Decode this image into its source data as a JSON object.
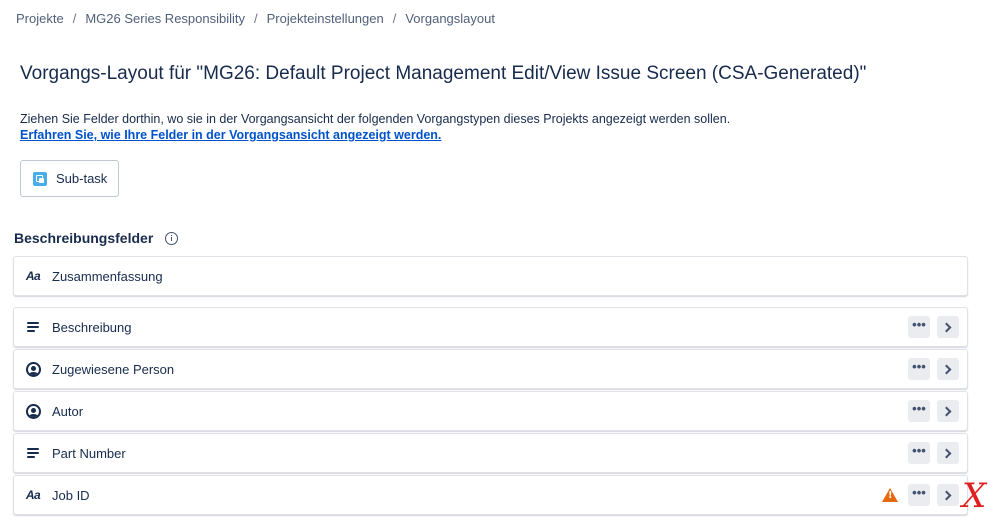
{
  "breadcrumb": {
    "items": [
      "Projekte",
      "MG26 Series Responsibility",
      "Projekteinstellungen",
      "Vorgangslayout"
    ],
    "separator": "/"
  },
  "page": {
    "title": "Vorgangs-Layout für \"MG26: Default Project Management Edit/View Issue Screen (CSA-Generated)\"",
    "description": "Ziehen Sie Felder dorthin, wo sie in der Vorgangsansicht der folgenden Vorgangstypen dieses Projekts angezeigt werden sollen.",
    "learn_more_link": "Erfahren Sie, wie Ihre Felder in der Vorgangsansicht angezeigt werden."
  },
  "issue_types": [
    {
      "label": "Sub-task",
      "icon": "subtask-icon",
      "color": "#4bade8"
    }
  ],
  "section": {
    "title": "Beschreibungsfelder",
    "info_icon": "info-icon"
  },
  "fields": [
    {
      "label": "Zusammenfassung",
      "icon": "text-field-icon",
      "actions": false,
      "warning": false
    },
    {
      "label": "Beschreibung",
      "icon": "paragraph-icon",
      "actions": true,
      "warning": false
    },
    {
      "label": "Zugewiesene Person",
      "icon": "person-icon",
      "actions": true,
      "warning": false
    },
    {
      "label": "Autor",
      "icon": "person-icon",
      "actions": true,
      "warning": false
    },
    {
      "label": "Part Number",
      "icon": "paragraph-icon",
      "actions": true,
      "warning": false
    },
    {
      "label": "Job ID",
      "icon": "text-field-icon",
      "actions": true,
      "warning": true
    }
  ],
  "icons": {
    "text_field_glyph": "Aa",
    "more_glyph": "•••",
    "annotation_mark": "X"
  },
  "colors": {
    "link": "#0052cc",
    "warning": "#e56910",
    "annotation": "#e02020",
    "action_bg": "#ebecf0"
  }
}
